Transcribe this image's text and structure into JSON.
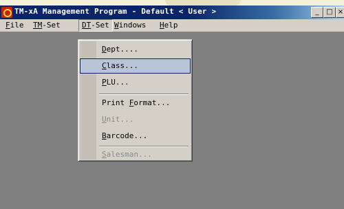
{
  "window": {
    "title": "TM-xA Management Program - Default < User >",
    "buttons": {
      "minimize": "_",
      "maximize": "□",
      "close": "×"
    }
  },
  "menubar": {
    "items": [
      {
        "label_acc": "F",
        "label_rest": "ile"
      },
      {
        "label_acc": "T",
        "label_mid": "M",
        "label_rest": "-Set"
      },
      {
        "label_acc": "D",
        "label_mid": "T",
        "label_rest": "-Set"
      },
      {
        "label_acc": "W",
        "label_rest": "indows"
      },
      {
        "label_acc": "H",
        "label_rest": "elp"
      }
    ],
    "active_index": 2
  },
  "dropdown": {
    "items": [
      {
        "acc": "D",
        "rest": "ept....",
        "enabled": true
      },
      {
        "acc": "C",
        "rest": "lass...",
        "enabled": true,
        "selected": true
      },
      {
        "acc": "P",
        "rest": "LU...",
        "enabled": true
      },
      {
        "pre": "Print ",
        "acc": "F",
        "rest": "ormat...",
        "enabled": true
      },
      {
        "acc": "U",
        "rest": "nit...",
        "enabled": false
      },
      {
        "acc": "B",
        "rest": "arcode...",
        "enabled": true
      },
      {
        "acc": "S",
        "rest": "alesman...",
        "enabled": false
      }
    ]
  },
  "colors": {
    "accent": "#0a246a",
    "selection": "#b9c4d8",
    "workspace": "#808080"
  }
}
